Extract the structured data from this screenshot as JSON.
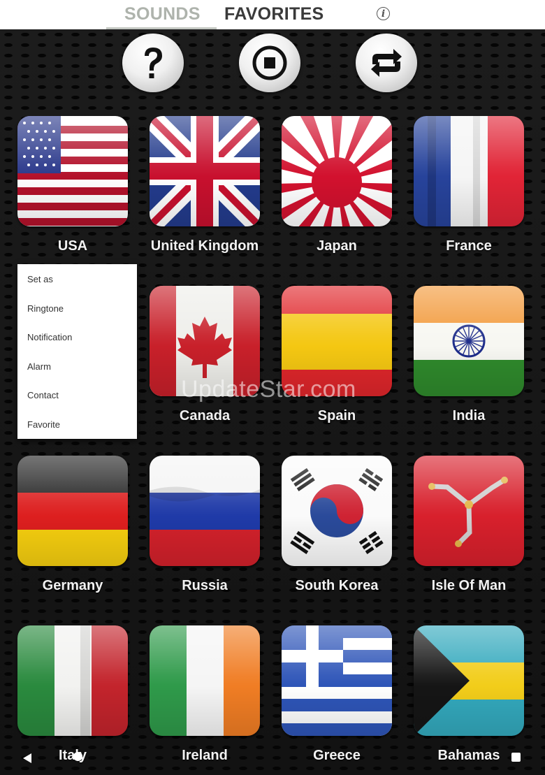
{
  "tabs": {
    "sounds": "SOUNDS",
    "favorites": "FAVORITES",
    "info_glyph": "i"
  },
  "controls": [
    {
      "name": "help",
      "icon": "question-icon"
    },
    {
      "name": "stop",
      "icon": "stop-icon"
    },
    {
      "name": "repeat",
      "icon": "repeat-icon"
    }
  ],
  "flags": [
    "USA",
    "United Kingdom",
    "Japan",
    "France",
    "Canada",
    "Spain",
    "India",
    "Germany",
    "Russia",
    "South Korea",
    "Isle Of Man",
    "Italy",
    "Ireland",
    "Greece",
    "Bahamas"
  ],
  "menu": {
    "title": "Set as",
    "items": [
      "Ringtone",
      "Notification",
      "Alarm",
      "Contact",
      "Favorite"
    ]
  },
  "watermark": "UpdateStar.com",
  "colors": {
    "tab_active": "#3a3a3a",
    "tab_inactive": "#aeb3ac",
    "label": "#f2f2f2"
  }
}
